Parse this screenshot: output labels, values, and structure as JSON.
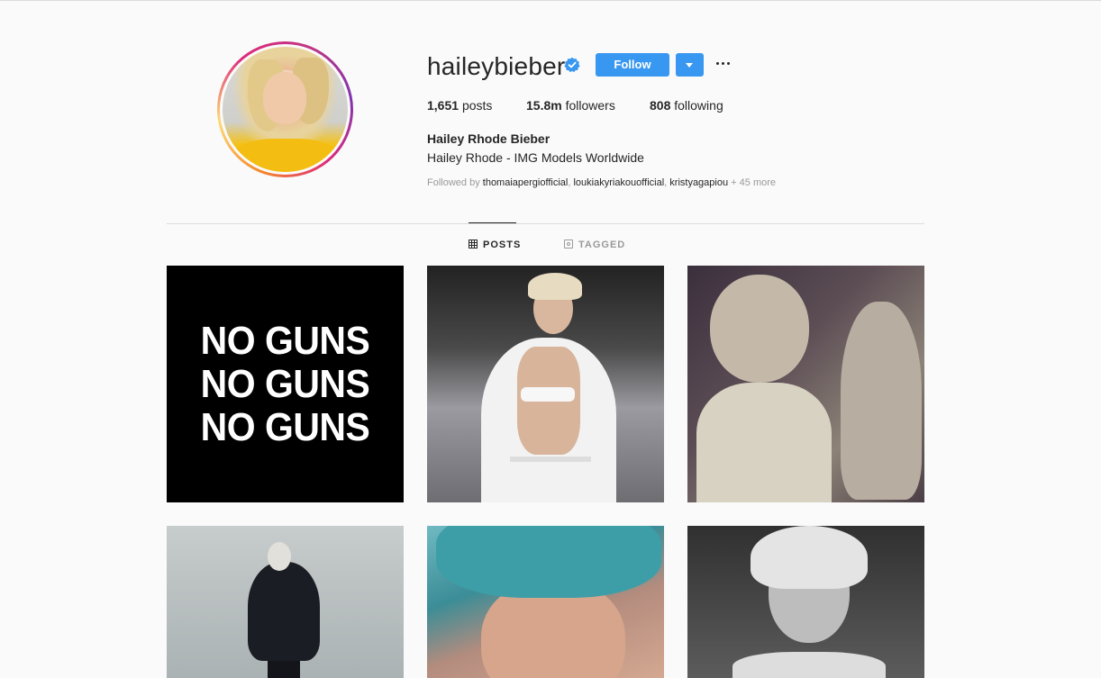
{
  "profile": {
    "username": "haileybieber",
    "follow_label": "Follow",
    "stats": {
      "posts_count": "1,651",
      "posts_label": "posts",
      "followers_count": "15.8m",
      "followers_label": "followers",
      "following_count": "808",
      "following_label": "following"
    },
    "full_name": "Hailey Rhode Bieber",
    "bio": "Hailey Rhode - IMG Models Worldwide",
    "followed_by": {
      "prefix": "Followed by",
      "accounts": [
        "thomaiapergiofficial",
        "loukiakyriakouofficial",
        "kristyagapiou"
      ],
      "more": "+ 45 more"
    }
  },
  "tabs": [
    {
      "label": "POSTS",
      "icon": "grid-icon",
      "active": true
    },
    {
      "label": "TAGGED",
      "icon": "tag-icon",
      "active": false
    }
  ],
  "posts": {
    "first_post_text": [
      "NO GUNS",
      "NO GUNS",
      "NO GUNS"
    ]
  },
  "colors": {
    "accent": "#3897f0",
    "background": "#fafafa",
    "text": "#262626",
    "muted": "#999999"
  }
}
